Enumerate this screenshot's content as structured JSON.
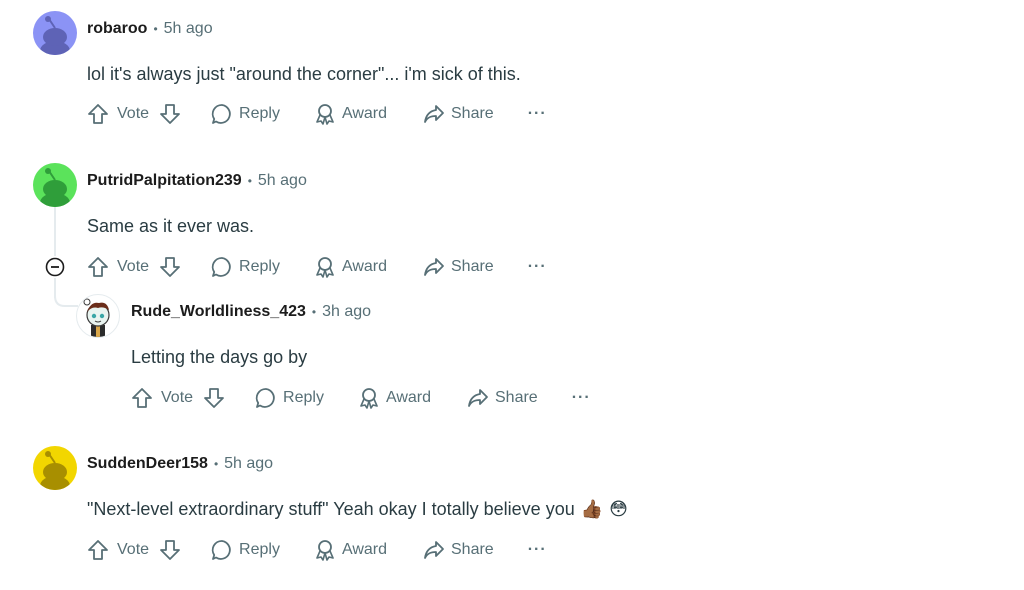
{
  "comments": [
    {
      "username": "robaroo",
      "time": "5h ago",
      "text": "lol it's always just \"around the corner\"... i'm sick of this.",
      "avatar_color": "#8b93f5"
    },
    {
      "username": "PutridPalpitation239",
      "time": "5h ago",
      "text": "Same as it ever was.",
      "avatar_color": "#5be35b"
    },
    {
      "username": "Rude_Worldliness_423",
      "time": "3h ago",
      "text": "Letting the days go by",
      "avatar_color": "#ffffff"
    },
    {
      "username": "SuddenDeer158",
      "time": "5h ago",
      "text": "\"Next-level extraordinary stuff\" Yeah okay I totally believe you",
      "emojis": [
        "👍🏾",
        "😳"
      ],
      "avatar_color": "#f2d600"
    }
  ],
  "actions": {
    "vote": "Vote",
    "reply": "Reply",
    "award": "Award",
    "share": "Share",
    "more": "···"
  },
  "separator": "•",
  "icons": {
    "upvote": "arrow-up-icon",
    "downvote": "arrow-down-icon",
    "reply": "comment-bubble-icon",
    "award": "award-ribbon-icon",
    "share": "share-arrow-icon",
    "collapse": "minus-circle-icon"
  }
}
